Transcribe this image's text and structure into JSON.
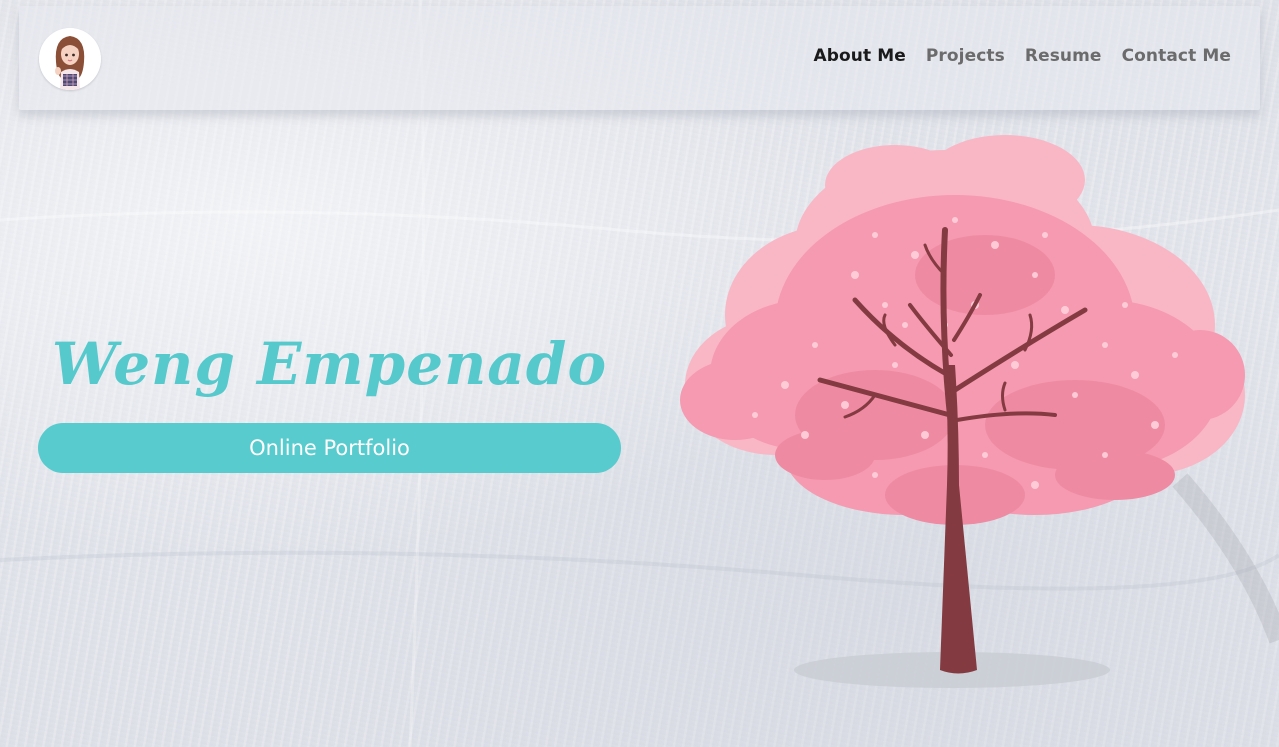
{
  "nav": {
    "avatar_icon": "profile-avatar-icon",
    "links": [
      {
        "label": "About Me",
        "active": true
      },
      {
        "label": "Projects",
        "active": false
      },
      {
        "label": "Resume",
        "active": false
      },
      {
        "label": "Contact Me",
        "active": false
      }
    ]
  },
  "hero": {
    "name": "Weng Empenado",
    "subtitle": "Online Portfolio",
    "illustration": "cherry-blossom-tree-icon"
  },
  "colors": {
    "accent": "#57cbcd",
    "nav_active": "#1a1a1a",
    "nav_inactive": "#6b6b6b",
    "blossom": "#f7a1b4",
    "trunk": "#833a41"
  }
}
